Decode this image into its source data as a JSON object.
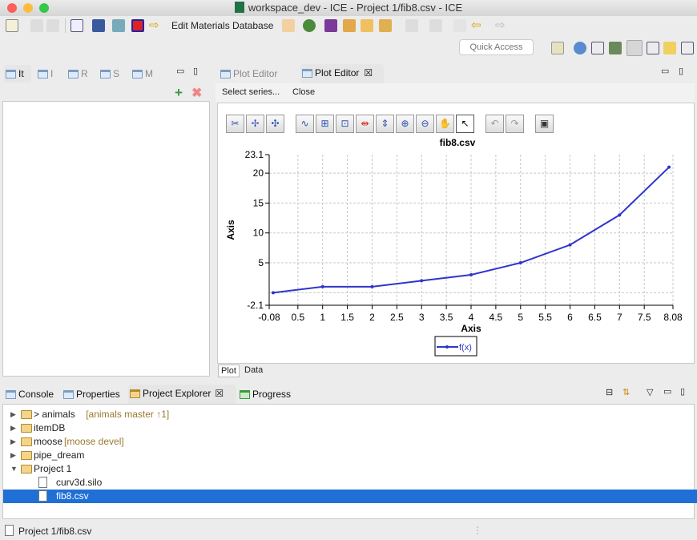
{
  "window": {
    "title": "workspace_dev - ICE - Project 1/fib8.csv - ICE"
  },
  "toolbar": {
    "edit_materials": "Edit Materials Database",
    "quick_access_placeholder": "Quick Access"
  },
  "left_panel": {
    "tabs": [
      {
        "label": "It"
      },
      {
        "label": "I"
      },
      {
        "label": "R"
      },
      {
        "label": "S"
      },
      {
        "label": "M"
      }
    ]
  },
  "editor": {
    "tabs": [
      {
        "label": "Plot Editor",
        "active": false
      },
      {
        "label": "Plot Editor",
        "active": true
      }
    ],
    "select_series": "Select series...",
    "close": "Close",
    "bottom_tabs": [
      {
        "label": "Plot"
      },
      {
        "label": "Data"
      }
    ]
  },
  "chart_data": {
    "type": "line",
    "title": "fib8.csv",
    "xlabel": "Axis",
    "ylabel": "Axis",
    "xlim": [
      -0.08,
      8.08
    ],
    "ylim": [
      -2.1,
      23.1
    ],
    "xticks": [
      "-0.08",
      "0.5",
      "1",
      "1.5",
      "2",
      "2.5",
      "3",
      "3.5",
      "4",
      "4.5",
      "5",
      "5.5",
      "6",
      "6.5",
      "7",
      "7.5",
      "8.08"
    ],
    "yticks": [
      "-2.1",
      "5",
      "10",
      "15",
      "20",
      "23.1"
    ],
    "grid": true,
    "legend_placement": "bottom",
    "series": [
      {
        "name": "f(x)",
        "color": "#2f35c9",
        "x": [
          0,
          1,
          2,
          3,
          4,
          5,
          6,
          7,
          8
        ],
        "y": [
          0,
          1,
          1,
          2,
          3,
          5,
          8,
          13,
          21
        ]
      }
    ]
  },
  "bottom_panel": {
    "tabs": [
      {
        "label": "Console"
      },
      {
        "label": "Properties"
      },
      {
        "label": "Project Explorer",
        "active": true
      },
      {
        "label": "Progress"
      }
    ],
    "tree": [
      {
        "label": "> animals",
        "decoration": "[animals master ↑1]",
        "level": 0,
        "expanded": false,
        "type": "project"
      },
      {
        "label": "itemDB",
        "decoration": "",
        "level": 0,
        "expanded": false,
        "type": "project"
      },
      {
        "label": "moose",
        "decoration": "[moose devel]",
        "level": 0,
        "expanded": false,
        "type": "project"
      },
      {
        "label": "pipe_dream",
        "decoration": "",
        "level": 0,
        "expanded": false,
        "type": "project"
      },
      {
        "label": "Project 1",
        "decoration": "",
        "level": 0,
        "expanded": true,
        "type": "project"
      },
      {
        "label": "curv3d.silo",
        "decoration": "",
        "level": 1,
        "type": "file"
      },
      {
        "label": "fib8.csv",
        "decoration": "",
        "level": 1,
        "type": "file",
        "selected": true
      }
    ]
  },
  "status_bar": {
    "text": "Project 1/fib8.csv"
  }
}
